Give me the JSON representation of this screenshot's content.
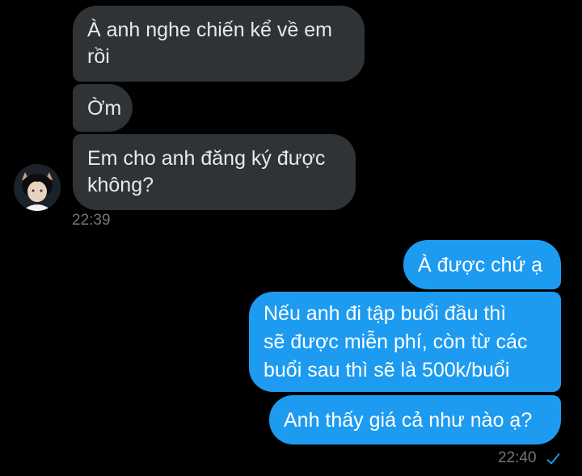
{
  "messages": [
    {
      "side": "incoming",
      "text": "À anh nghe chiến kể về em\nrồi"
    },
    {
      "side": "incoming",
      "text": "Ờm"
    },
    {
      "side": "incoming",
      "text": "Em cho anh đăng ký được\nkhông?"
    },
    {
      "side": "outgoing",
      "text": "À được chứ ạ"
    },
    {
      "side": "outgoing",
      "text": "Nếu anh đi tập buổi đầu thì\nsẽ được miễn phí, còn từ các\nbuổi sau thì sẽ là 500k/buổi"
    },
    {
      "side": "outgoing",
      "text": "Anh thấy giá cả như nào ạ?"
    }
  ],
  "timestamps": {
    "incoming": "22:39",
    "outgoing": "22:40"
  },
  "icons": {
    "avatar": "avatar-icon",
    "read_receipt": "checkmark-icon"
  },
  "colors": {
    "background": "#000000",
    "incoming_bubble": "#2f3336",
    "outgoing_bubble": "#1d9bf0",
    "timestamp": "#71767b"
  }
}
